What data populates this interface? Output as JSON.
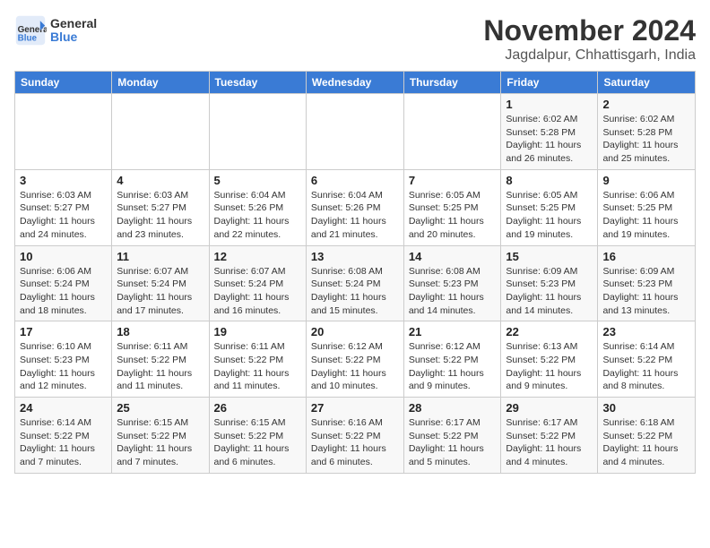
{
  "header": {
    "logo_line1": "General",
    "logo_line2": "Blue",
    "month": "November 2024",
    "location": "Jagdalpur, Chhattisgarh, India"
  },
  "weekdays": [
    "Sunday",
    "Monday",
    "Tuesday",
    "Wednesday",
    "Thursday",
    "Friday",
    "Saturday"
  ],
  "weeks": [
    [
      {
        "day": "",
        "info": ""
      },
      {
        "day": "",
        "info": ""
      },
      {
        "day": "",
        "info": ""
      },
      {
        "day": "",
        "info": ""
      },
      {
        "day": "",
        "info": ""
      },
      {
        "day": "1",
        "info": "Sunrise: 6:02 AM\nSunset: 5:28 PM\nDaylight: 11 hours and 26 minutes."
      },
      {
        "day": "2",
        "info": "Sunrise: 6:02 AM\nSunset: 5:28 PM\nDaylight: 11 hours and 25 minutes."
      }
    ],
    [
      {
        "day": "3",
        "info": "Sunrise: 6:03 AM\nSunset: 5:27 PM\nDaylight: 11 hours and 24 minutes."
      },
      {
        "day": "4",
        "info": "Sunrise: 6:03 AM\nSunset: 5:27 PM\nDaylight: 11 hours and 23 minutes."
      },
      {
        "day": "5",
        "info": "Sunrise: 6:04 AM\nSunset: 5:26 PM\nDaylight: 11 hours and 22 minutes."
      },
      {
        "day": "6",
        "info": "Sunrise: 6:04 AM\nSunset: 5:26 PM\nDaylight: 11 hours and 21 minutes."
      },
      {
        "day": "7",
        "info": "Sunrise: 6:05 AM\nSunset: 5:25 PM\nDaylight: 11 hours and 20 minutes."
      },
      {
        "day": "8",
        "info": "Sunrise: 6:05 AM\nSunset: 5:25 PM\nDaylight: 11 hours and 19 minutes."
      },
      {
        "day": "9",
        "info": "Sunrise: 6:06 AM\nSunset: 5:25 PM\nDaylight: 11 hours and 19 minutes."
      }
    ],
    [
      {
        "day": "10",
        "info": "Sunrise: 6:06 AM\nSunset: 5:24 PM\nDaylight: 11 hours and 18 minutes."
      },
      {
        "day": "11",
        "info": "Sunrise: 6:07 AM\nSunset: 5:24 PM\nDaylight: 11 hours and 17 minutes."
      },
      {
        "day": "12",
        "info": "Sunrise: 6:07 AM\nSunset: 5:24 PM\nDaylight: 11 hours and 16 minutes."
      },
      {
        "day": "13",
        "info": "Sunrise: 6:08 AM\nSunset: 5:24 PM\nDaylight: 11 hours and 15 minutes."
      },
      {
        "day": "14",
        "info": "Sunrise: 6:08 AM\nSunset: 5:23 PM\nDaylight: 11 hours and 14 minutes."
      },
      {
        "day": "15",
        "info": "Sunrise: 6:09 AM\nSunset: 5:23 PM\nDaylight: 11 hours and 14 minutes."
      },
      {
        "day": "16",
        "info": "Sunrise: 6:09 AM\nSunset: 5:23 PM\nDaylight: 11 hours and 13 minutes."
      }
    ],
    [
      {
        "day": "17",
        "info": "Sunrise: 6:10 AM\nSunset: 5:23 PM\nDaylight: 11 hours and 12 minutes."
      },
      {
        "day": "18",
        "info": "Sunrise: 6:11 AM\nSunset: 5:22 PM\nDaylight: 11 hours and 11 minutes."
      },
      {
        "day": "19",
        "info": "Sunrise: 6:11 AM\nSunset: 5:22 PM\nDaylight: 11 hours and 11 minutes."
      },
      {
        "day": "20",
        "info": "Sunrise: 6:12 AM\nSunset: 5:22 PM\nDaylight: 11 hours and 10 minutes."
      },
      {
        "day": "21",
        "info": "Sunrise: 6:12 AM\nSunset: 5:22 PM\nDaylight: 11 hours and 9 minutes."
      },
      {
        "day": "22",
        "info": "Sunrise: 6:13 AM\nSunset: 5:22 PM\nDaylight: 11 hours and 9 minutes."
      },
      {
        "day": "23",
        "info": "Sunrise: 6:14 AM\nSunset: 5:22 PM\nDaylight: 11 hours and 8 minutes."
      }
    ],
    [
      {
        "day": "24",
        "info": "Sunrise: 6:14 AM\nSunset: 5:22 PM\nDaylight: 11 hours and 7 minutes."
      },
      {
        "day": "25",
        "info": "Sunrise: 6:15 AM\nSunset: 5:22 PM\nDaylight: 11 hours and 7 minutes."
      },
      {
        "day": "26",
        "info": "Sunrise: 6:15 AM\nSunset: 5:22 PM\nDaylight: 11 hours and 6 minutes."
      },
      {
        "day": "27",
        "info": "Sunrise: 6:16 AM\nSunset: 5:22 PM\nDaylight: 11 hours and 6 minutes."
      },
      {
        "day": "28",
        "info": "Sunrise: 6:17 AM\nSunset: 5:22 PM\nDaylight: 11 hours and 5 minutes."
      },
      {
        "day": "29",
        "info": "Sunrise: 6:17 AM\nSunset: 5:22 PM\nDaylight: 11 hours and 4 minutes."
      },
      {
        "day": "30",
        "info": "Sunrise: 6:18 AM\nSunset: 5:22 PM\nDaylight: 11 hours and 4 minutes."
      }
    ]
  ]
}
